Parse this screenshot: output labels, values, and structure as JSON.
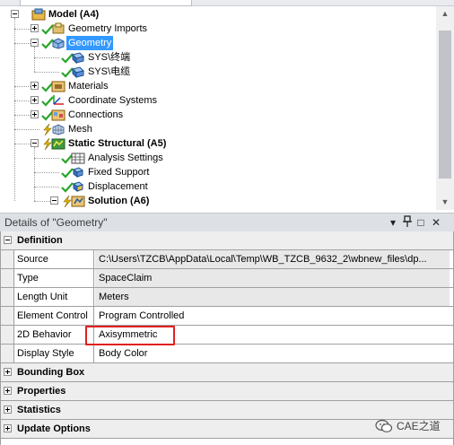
{
  "tree": {
    "nodes": [
      {
        "label": "Model (A4)",
        "icon": "model-icon",
        "status": "none",
        "expander": "minus",
        "bold": true
      },
      {
        "label": "Geometry Imports",
        "icon": "geometry-imports-icon",
        "status": "check",
        "expander": "plus",
        "bold": false
      },
      {
        "label": "Geometry",
        "icon": "geometry-icon",
        "status": "check",
        "expander": "minus",
        "bold": false,
        "selected": true
      },
      {
        "label": "SYS\\终端",
        "icon": "body-icon",
        "status": "check",
        "expander": "none",
        "bold": false
      },
      {
        "label": "SYS\\电缆",
        "icon": "body-icon",
        "status": "check",
        "expander": "none",
        "bold": false
      },
      {
        "label": "Materials",
        "icon": "materials-icon",
        "status": "check",
        "expander": "plus",
        "bold": false
      },
      {
        "label": "Coordinate Systems",
        "icon": "coordinate-systems-icon",
        "status": "check",
        "expander": "plus",
        "bold": false
      },
      {
        "label": "Connections",
        "icon": "connections-icon",
        "status": "check",
        "expander": "plus",
        "bold": false
      },
      {
        "label": "Mesh",
        "icon": "mesh-icon",
        "status": "lightning",
        "expander": "none",
        "bold": false
      },
      {
        "label": "Static Structural (A5)",
        "icon": "static-structural-icon",
        "status": "lightning",
        "expander": "minus",
        "bold": true
      },
      {
        "label": "Analysis Settings",
        "icon": "analysis-settings-icon",
        "status": "check",
        "expander": "none",
        "bold": false
      },
      {
        "label": "Fixed Support",
        "icon": "fixed-support-icon",
        "status": "check",
        "expander": "none",
        "bold": false
      },
      {
        "label": "Displacement",
        "icon": "displacement-icon",
        "status": "check",
        "expander": "none",
        "bold": false
      },
      {
        "label": "Solution (A6)",
        "icon": "solution-icon",
        "status": "lightning",
        "expander": "minus",
        "bold": true
      }
    ]
  },
  "details": {
    "title": "Details of \"Geometry\"",
    "buttons": {
      "menu": "▾",
      "pin": "🖈",
      "dock": "□",
      "close": "✕"
    },
    "categories": [
      {
        "label": "Definition",
        "expanded": true,
        "properties": [
          {
            "name": "Source",
            "value": "C:\\Users\\TZCB\\AppData\\Local\\Temp\\WB_TZCB_9632_2\\wbnew_files\\dp...",
            "readonly": true
          },
          {
            "name": "Type",
            "value": "SpaceClaim",
            "readonly": true
          },
          {
            "name": "Length Unit",
            "value": "Meters",
            "readonly": true
          },
          {
            "name": "Element Control",
            "value": "Program Controlled",
            "readonly": false
          },
          {
            "name": "2D Behavior",
            "value": "Axisymmetric",
            "readonly": false
          },
          {
            "name": "Display Style",
            "value": "Body Color",
            "readonly": false
          }
        ]
      },
      {
        "label": "Bounding Box",
        "expanded": false
      },
      {
        "label": "Properties",
        "expanded": false
      },
      {
        "label": "Statistics",
        "expanded": false
      },
      {
        "label": "Update Options",
        "expanded": false
      }
    ]
  },
  "watermark": {
    "text": "CAE之道"
  },
  "colors": {
    "selection": "#3399ff",
    "highlight_box": "#e02020",
    "check": "#2aa52a",
    "lightning": "#e6b400"
  }
}
